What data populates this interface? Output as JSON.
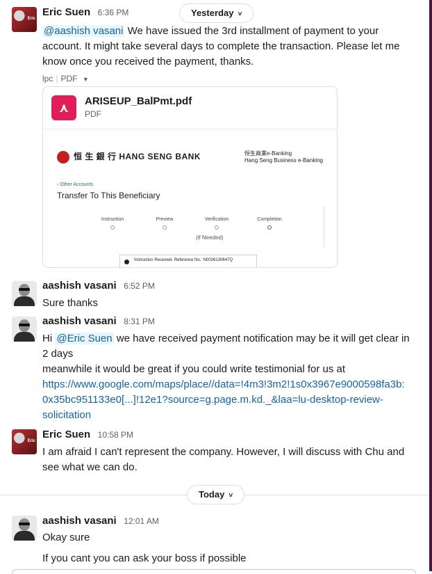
{
  "dividers": {
    "yesterday": "Yesterday",
    "today": "Today"
  },
  "messages": [
    {
      "author": "Eric Suen",
      "time": "6:36 PM",
      "mention": "@aashish vasani",
      "text": " We have issued the 3rd installment of payment to your account. It might take several days to complete the transaction. Please let me know once you received the payment, thanks.",
      "file_meta": {
        "channel": "lpc",
        "type": "PDF"
      },
      "file": {
        "name": "ARISEUP_BalPmt.pdf",
        "type": "PDF",
        "preview": {
          "bank_name": "恒 生 銀 行  HANG SENG BANK",
          "ebank_line1": "恒生商業e-Banking",
          "ebank_line2": "Hang Seng Business e-Banking",
          "back": "‹ Other Accounts",
          "title": "Transfer To This Beneficiary",
          "steps": [
            "Instruction",
            "Preview",
            "Verification",
            "Completion"
          ],
          "if_needed": "(if Needed)",
          "notice": "Instruction Received. Reference No.: N0026130647Q"
        }
      }
    },
    {
      "author": "aashish vasani",
      "time": "6:52 PM",
      "text": "Sure thanks"
    },
    {
      "author": "aashish vasani",
      "time": "8:31 PM",
      "prefix": "Hi ",
      "mention": "@Eric Suen",
      "text": " we have received payment notification may be it will get clear in 2 days",
      "line2": "meanwhile it would be great if you could write testimonial for us at",
      "link_lines": [
        "https://www.google.com/maps/place//data=!4m3!3m2!1s0x3967e9000598fa3b:",
        "0x35bc951133e0[...]!12e1?source=g.page.m.kd._&laa=lu-desktop-review-",
        "solicitation"
      ]
    },
    {
      "author": "Eric Suen",
      "time": "10:58 PM",
      "text": "I am afraid I can't represent the company. However, I will discuss with Chu and see what we can do."
    },
    {
      "author": "aashish vasani",
      "time": "12:01 AM",
      "text": "Okay sure",
      "followup": "If you cant you can ask your boss if possible"
    }
  ]
}
